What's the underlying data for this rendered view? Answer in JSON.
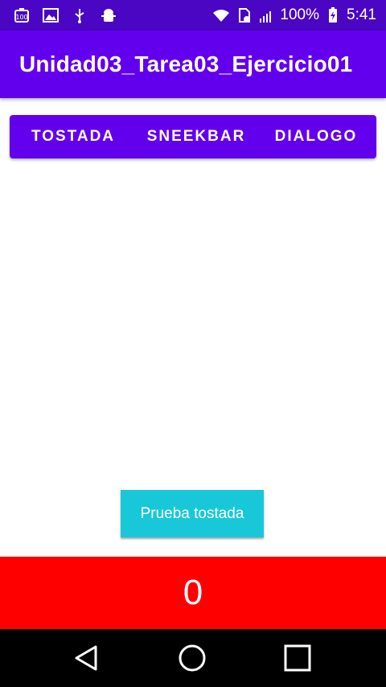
{
  "status_bar": {
    "battery": "100%",
    "time": "5:41",
    "icons": [
      "battery-100-notification-icon",
      "image-icon",
      "usb-icon",
      "android-debug-icon",
      "wifi-icon",
      "sim-missing-icon",
      "signal-icon",
      "battery-charging-icon"
    ]
  },
  "app_bar": {
    "title": "Unidad03_Tarea03_Ejercicio01"
  },
  "tabs": [
    {
      "label": "TOSTADA"
    },
    {
      "label": "SNEEKBAR"
    },
    {
      "label": "DIALOGO"
    }
  ],
  "test_button": {
    "label": "Prueba tostada"
  },
  "counter": {
    "value": "0"
  },
  "nav": {
    "icons": [
      "back-icon",
      "home-icon",
      "recents-icon"
    ]
  },
  "colors": {
    "status_bar": "#4a06c2",
    "primary": "#6200ee",
    "button": "#19c8d8",
    "counter_bg": "#ff0000"
  }
}
